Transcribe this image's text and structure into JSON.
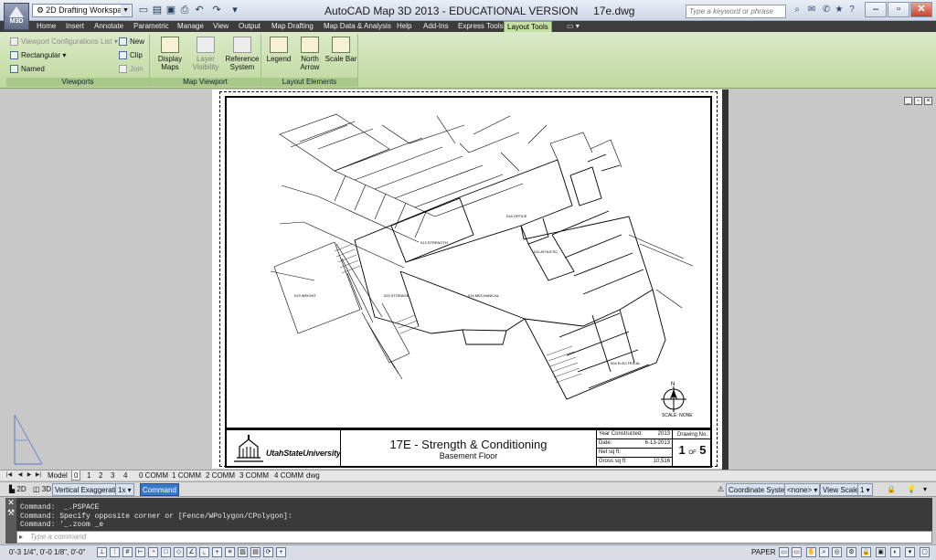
{
  "window": {
    "app_logo": "M3D",
    "workspace": "2D Drafting Workspace",
    "title": "AutoCAD Map 3D 2013 - EDUCATIONAL VERSION",
    "file": "17e.dwg",
    "search_placeholder": "Type a keyword or phrase"
  },
  "menu_tabs": [
    "Home",
    "Insert",
    "Annotate",
    "Parametric",
    "Manage",
    "View",
    "Output",
    "Map Drafting",
    "Map Data & Analysis",
    "Help",
    "Add-Ins",
    "Express Tools",
    "Layout Tools"
  ],
  "ribbon": {
    "viewports": {
      "label": "Viewports",
      "config_list": "Viewport Configurations List",
      "rectangular": "Rectangular",
      "named": "Named",
      "new": "New",
      "clip": "Clip",
      "join": "Join"
    },
    "map_viewport": {
      "label": "Map Viewport",
      "display_maps": "Display Maps",
      "layer_visibility": "Layer Visibility",
      "reference_system": "Reference System"
    },
    "layout_elements": {
      "label": "Layout Elements",
      "legend": "Legend",
      "north_arrow": "North Arrow",
      "scale_bar": "Scale Bar"
    }
  },
  "drawing": {
    "rooms": [
      "018 OFFICE",
      "016 MECHANICAL",
      "013 STRENGTH",
      "011 ATHLETIC",
      "019 WEIGHT",
      "020 STORAGE",
      "004 ELECTRICAL"
    ],
    "scale_label": "SCALE: NONE",
    "north_label": "N"
  },
  "title_block": {
    "university": "UtahStateUniversity",
    "title": "17E - Strength & Conditioning",
    "subtitle": "Basement Floor",
    "fields": [
      {
        "label": "Year Constructed:",
        "value": "2013"
      },
      {
        "label": "Date:",
        "value": "6-13-2013"
      },
      {
        "label": "Net sq ft:",
        "value": ""
      },
      {
        "label": "Gross sq ft:",
        "value": "10,516"
      }
    ],
    "drawing_no_label": "Drawing No.",
    "sheet": "1",
    "sheet_of": "OF",
    "sheet_total": "5"
  },
  "layout_tabs": [
    "Model",
    "0",
    "1",
    "2",
    "3",
    "4",
    "0 COMM",
    "1 COMM",
    "2 COMM",
    "3 COMM",
    "4 COMM",
    "dwg"
  ],
  "status_strip": {
    "btn_2d": "2D",
    "btn_3d": "3D",
    "vertical_exaggeration": "Vertical Exaggeration:",
    "exaggeration_value": "1x",
    "command_label": "Command",
    "coordinate_system": "Coordinate System:",
    "coordinate_value": "<none>",
    "view_scale": "View Scale",
    "view_scale_value": "1"
  },
  "command": {
    "history": [
      "Command:  _.PSPACE",
      "Command: Specify opposite corner or [Fence/WPolygon/CPolygon]:",
      "Command: '_.zoom _e"
    ],
    "placeholder": "Type a command"
  },
  "statusbar": {
    "coordinates": "0'-3 1/4\",  0'-0 1/8\",  0'-0\"",
    "space": "PAPER"
  },
  "colors": {
    "ribbon_green": "#c6e0a4",
    "menu_dark": "#3c3c3c",
    "command_bg": "#3a3a3a",
    "close_red": "#c2462f"
  }
}
